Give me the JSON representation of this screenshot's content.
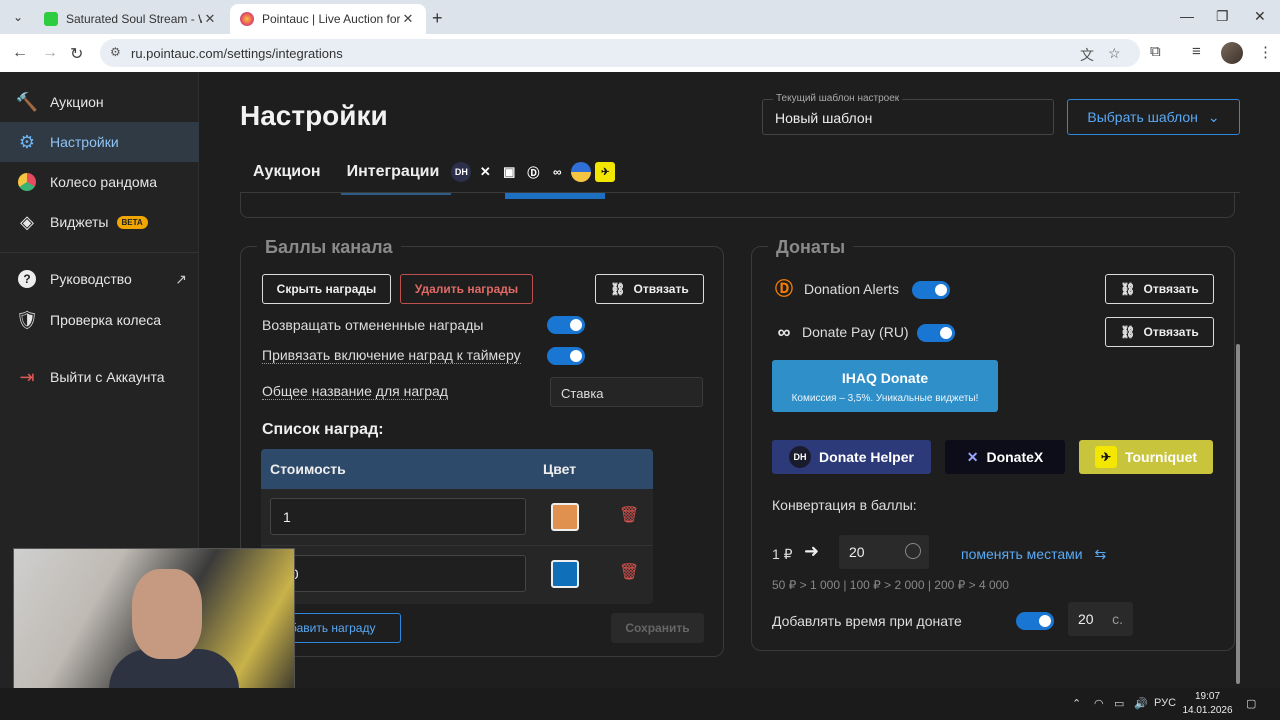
{
  "browser": {
    "tabs": [
      {
        "title": "Saturated Soul Stream - Watch",
        "active": false
      },
      {
        "title": "Pointauc | Live Auction for Stre",
        "active": true
      }
    ],
    "url": "ru.pointauc.com/settings/integrations"
  },
  "sidebar": {
    "items": [
      {
        "label": "Аукцион",
        "icon": "hammer-icon"
      },
      {
        "label": "Настройки",
        "icon": "gear-icon",
        "active": true
      },
      {
        "label": "Колесо рандома",
        "icon": "wheel-icon"
      },
      {
        "label": "Виджеты",
        "icon": "layers-icon",
        "badge": "BETA"
      },
      {
        "label": "Руководство",
        "icon": "help-icon"
      },
      {
        "label": "Проверка колеса",
        "icon": "shield-check-icon"
      },
      {
        "label": "Выйти с Аккаунта",
        "icon": "logout-icon"
      }
    ]
  },
  "header": {
    "title": "Настройки",
    "template_label": "Текущий шаблон настроек",
    "template_value": "Новый шаблон",
    "choose_template": "Выбрать шаблон"
  },
  "tabs": {
    "auction": "Аукцион",
    "integrations": "Интеграции",
    "integration_icons": [
      "DH",
      "X",
      "twitch",
      "DA",
      "DP",
      "IHAQ",
      "T"
    ]
  },
  "channel_points": {
    "title": "Баллы канала",
    "hide_rewards": "Скрыть награды",
    "delete_rewards": "Удалить награды",
    "unlink": "Отвязать",
    "return_cancelled": "Возвращать отмененные награды",
    "bind_timer": "Привязать включение наград к таймеру",
    "common_name_label": "Общее название для наград",
    "common_name_value": "Ставка",
    "rewards_list": "Список наград:",
    "col_cost": "Стоимость",
    "col_color": "Цвет",
    "rows": [
      {
        "cost": "1",
        "color": "#e0914f"
      },
      {
        "cost": "00",
        "color": "#0f6fb8"
      }
    ],
    "add_reward": "бавить награду",
    "save": "Сохранить"
  },
  "donations": {
    "title": "Донаты",
    "donation_alerts": "Donation Alerts",
    "donate_pay": "Donate Pay (RU)",
    "unlink": "Отвязать",
    "ihaq_title": "IHAQ Donate",
    "ihaq_sub": "Комиссия – 3,5%. Уникальные виджеты!",
    "donate_helper": "Donate Helper",
    "donatex": "DonateX",
    "tourniquet": "Tourniquet",
    "conversion_label": "Конвертация в баллы:",
    "rate_left": "1 ₽",
    "rate_value": "20",
    "swap": "поменять местами",
    "examples": "50 ₽ > 1 000 | 100 ₽ > 2 000 | 200 ₽ > 4 000",
    "add_time_label": "Добавлять время при донате",
    "add_time_value": "20",
    "add_time_unit": "с."
  },
  "taskbar": {
    "lang": "РУС",
    "time": "19:07",
    "date": "14.01.2026"
  },
  "colors": {
    "accent": "#1976d2",
    "danger": "#d9534f",
    "ihaq": "#2e8fc9",
    "tourniquet": "#c8c43c",
    "donate_helper": "#2d3a7a"
  }
}
